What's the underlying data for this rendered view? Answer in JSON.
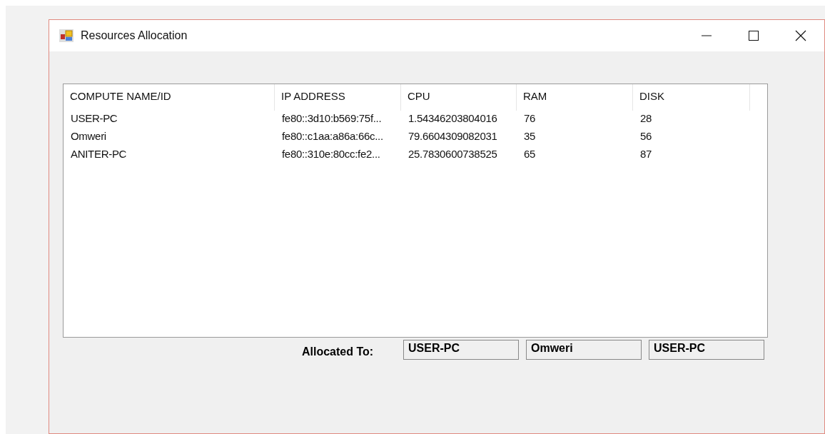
{
  "window": {
    "title": "Resources Allocation"
  },
  "table": {
    "columns": [
      "COMPUTE NAME/ID",
      "IP ADDRESS",
      "CPU",
      "RAM",
      "DISK"
    ],
    "rows": [
      [
        "USER-PC",
        "fe80::3d10:b569:75f...",
        "1.54346203804016",
        "76",
        "28"
      ],
      [
        "Omweri",
        "fe80::c1aa:a86a:66c...",
        "79.6604309082031",
        "35",
        "56"
      ],
      [
        "ANITER-PC",
        "fe80::310e:80cc:fe2...",
        "25.7830600738525",
        "65",
        "87"
      ]
    ]
  },
  "allocation": {
    "label": "Allocated To:",
    "values": [
      "USER-PC",
      "Omweri",
      "USER-PC"
    ]
  }
}
